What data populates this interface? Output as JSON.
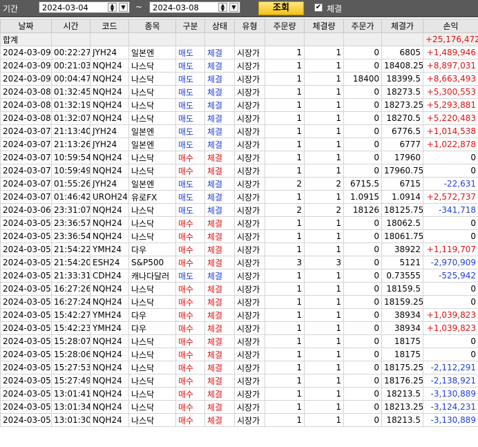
{
  "toolbar": {
    "period_label": "기간",
    "start_date": "2024-03-04",
    "end_date": "2024-03-08",
    "tilde": "~",
    "query_button": "조회",
    "filled_checkbox_label": "체결",
    "filled_checked": true
  },
  "table": {
    "columns": [
      "날짜",
      "시간",
      "코드",
      "종목",
      "구분",
      "상태",
      "유형",
      "주문량",
      "체결량",
      "주문가",
      "체결가",
      "손익"
    ],
    "total": {
      "label": "합계",
      "pnl": "+25,176,472"
    },
    "rows": [
      [
        "2024-03-09",
        "00:22:27",
        "JYH24",
        "일본엔",
        "매도",
        "체결",
        "시장가",
        "1",
        "1",
        "0",
        "6805",
        "+1,489,946"
      ],
      [
        "2024-03-09",
        "00:21:03",
        "NQH24",
        "나스닥",
        "매도",
        "체결",
        "시장가",
        "1",
        "1",
        "0",
        "18408.25",
        "+8,897,031"
      ],
      [
        "2024-03-09",
        "00:04:47",
        "NQH24",
        "나스닥",
        "매도",
        "체결",
        "시장가",
        "1",
        "1",
        "18400",
        "18399.5",
        "+8,663,493"
      ],
      [
        "2024-03-08",
        "01:32:45",
        "NQH24",
        "나스닥",
        "매도",
        "체결",
        "시장가",
        "1",
        "1",
        "0",
        "18273.5",
        "+5,300,553"
      ],
      [
        "2024-03-08",
        "01:32:19",
        "NQH24",
        "나스닥",
        "매도",
        "체결",
        "시장가",
        "1",
        "1",
        "0",
        "18273.25",
        "+5,293,881"
      ],
      [
        "2024-03-08",
        "01:32:07",
        "NQH24",
        "나스닥",
        "매도",
        "체결",
        "시장가",
        "1",
        "1",
        "0",
        "18270.5",
        "+5,220,483"
      ],
      [
        "2024-03-07",
        "21:13:40",
        "JYH24",
        "일본엔",
        "매도",
        "체결",
        "시장가",
        "1",
        "1",
        "0",
        "6776.5",
        "+1,014,538"
      ],
      [
        "2024-03-07",
        "21:13:26",
        "JYH24",
        "일본엔",
        "매도",
        "체결",
        "시장가",
        "1",
        "1",
        "0",
        "6777",
        "+1,022,878"
      ],
      [
        "2024-03-07",
        "10:59:54",
        "NQH24",
        "나스닥",
        "매수",
        "체결",
        "시장가",
        "1",
        "1",
        "0",
        "17960",
        "0"
      ],
      [
        "2024-03-07",
        "10:59:49",
        "NQH24",
        "나스닥",
        "매수",
        "체결",
        "시장가",
        "1",
        "1",
        "0",
        "17960.75",
        "0"
      ],
      [
        "2024-03-07",
        "01:55:26",
        "JYH24",
        "일본엔",
        "매도",
        "체결",
        "시장가",
        "2",
        "2",
        "6715.5",
        "6715",
        "-22,631"
      ],
      [
        "2024-03-07",
        "01:46:42",
        "UROH24",
        "유로FX",
        "매도",
        "체결",
        "시장가",
        "1",
        "1",
        "1.0915",
        "1.0914",
        "+2,572,737"
      ],
      [
        "2024-03-06",
        "23:31:07",
        "NQH24",
        "나스닥",
        "매도",
        "체결",
        "시장가",
        "2",
        "2",
        "18126",
        "18125.75",
        "-341,718"
      ],
      [
        "2024-03-05",
        "23:36:57",
        "NQH24",
        "나스닥",
        "매수",
        "체결",
        "시장가",
        "1",
        "1",
        "0",
        "18062.5",
        "0"
      ],
      [
        "2024-03-05",
        "23:36:54",
        "NQH24",
        "나스닥",
        "매수",
        "체결",
        "시장가",
        "1",
        "1",
        "0",
        "18061.75",
        "0"
      ],
      [
        "2024-03-05",
        "21:54:22",
        "YMH24",
        "다우",
        "매수",
        "체결",
        "시장가",
        "1",
        "1",
        "0",
        "38922",
        "+1,119,707"
      ],
      [
        "2024-03-05",
        "21:54:20",
        "ESH24",
        "S&P500",
        "매수",
        "체결",
        "시장가",
        "3",
        "3",
        "0",
        "5121",
        "-2,970,909"
      ],
      [
        "2024-03-05",
        "21:33:31",
        "CDH24",
        "캐나다달러",
        "매도",
        "체결",
        "시장가",
        "1",
        "1",
        "0",
        "0.73555",
        "-525,942"
      ],
      [
        "2024-03-05",
        "16:27:26",
        "NQH24",
        "나스닥",
        "매수",
        "체결",
        "시장가",
        "1",
        "1",
        "0",
        "18159.5",
        "0"
      ],
      [
        "2024-03-05",
        "16:27:24",
        "NQH24",
        "나스닥",
        "매수",
        "체결",
        "시장가",
        "1",
        "1",
        "0",
        "18159.25",
        "0"
      ],
      [
        "2024-03-05",
        "15:42:27",
        "YMH24",
        "다우",
        "매수",
        "체결",
        "시장가",
        "1",
        "1",
        "0",
        "38934",
        "+1,039,823"
      ],
      [
        "2024-03-05",
        "15:42:23",
        "YMH24",
        "다우",
        "매수",
        "체결",
        "시장가",
        "1",
        "1",
        "0",
        "38934",
        "+1,039,823"
      ],
      [
        "2024-03-05",
        "15:28:07",
        "NQH24",
        "나스닥",
        "매수",
        "체결",
        "시장가",
        "1",
        "1",
        "0",
        "18175",
        "0"
      ],
      [
        "2024-03-05",
        "15:28:06",
        "NQH24",
        "나스닥",
        "매수",
        "체결",
        "시장가",
        "1",
        "1",
        "0",
        "18175",
        "0"
      ],
      [
        "2024-03-05",
        "15:27:53",
        "NQH24",
        "나스닥",
        "매수",
        "체결",
        "시장가",
        "1",
        "1",
        "0",
        "18175.25",
        "-2,112,291"
      ],
      [
        "2024-03-05",
        "15:27:49",
        "NQH24",
        "나스닥",
        "매수",
        "체결",
        "시장가",
        "1",
        "1",
        "0",
        "18176.25",
        "-2,138,921"
      ],
      [
        "2024-03-05",
        "13:01:41",
        "NQH24",
        "나스닥",
        "매수",
        "체결",
        "시장가",
        "1",
        "1",
        "0",
        "18213.5",
        "-3,130,889"
      ],
      [
        "2024-03-05",
        "13:01:34",
        "NQH24",
        "나스닥",
        "매수",
        "체결",
        "시장가",
        "1",
        "1",
        "0",
        "18213.25",
        "-3,124,231"
      ],
      [
        "2024-03-05",
        "13:01:30",
        "NQH24",
        "나스닥",
        "매수",
        "체결",
        "시장가",
        "1",
        "1",
        "0",
        "18213.5",
        "-3,130,889"
      ]
    ]
  },
  "colors": {
    "sell": "#1f3fd6",
    "buy": "#e01010",
    "status": "#1f3fd6",
    "loss": "#1f3fd6",
    "profit": "#e01010"
  },
  "icons": {
    "spin": "spin-updown-icon",
    "dropdown": "chevron-down-icon",
    "check": "checkmark-icon"
  }
}
